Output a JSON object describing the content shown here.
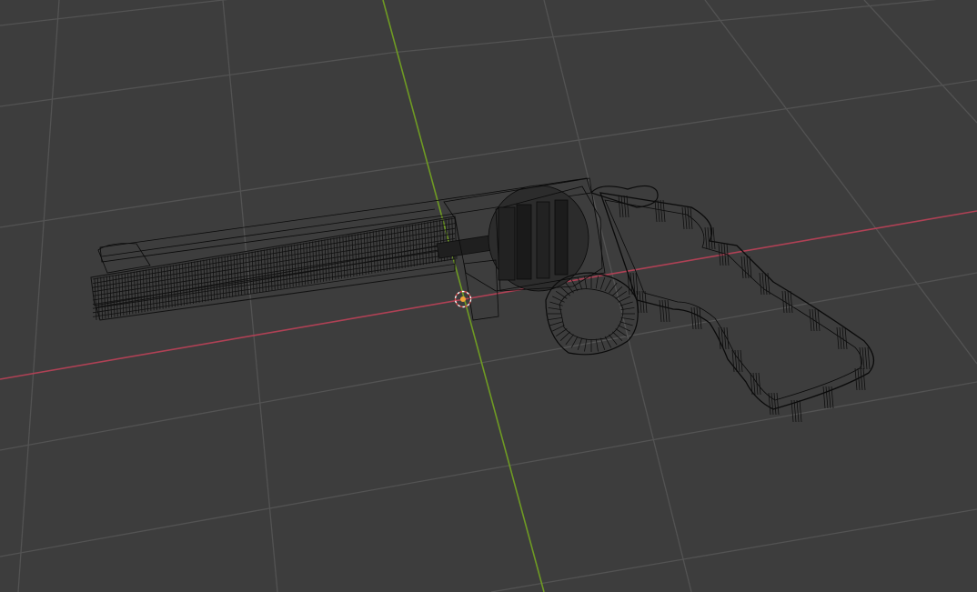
{
  "viewport": {
    "background_color": "#3d3d3d",
    "grid_color": "#535353",
    "x_axis_color": "#b04155",
    "y_axis_color": "#6f9b23",
    "origin_marker_color": "#f0a33a",
    "wire_color": "#0a0a0a"
  },
  "scene": {
    "object_shown": "revolver",
    "display_mode": "wireframe",
    "show_floor_grid": true,
    "show_axes": [
      "x",
      "y"
    ]
  },
  "icons": {
    "origin": "scene-origin-icon"
  }
}
